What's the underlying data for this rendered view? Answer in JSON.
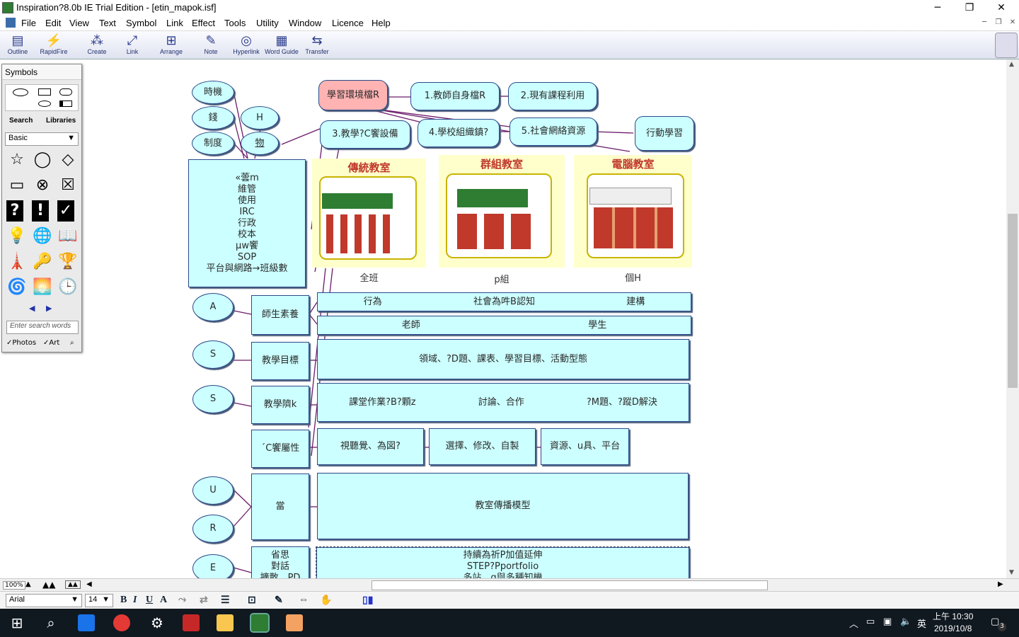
{
  "window": {
    "title": "Inspiration?8.0b IE Trial Edition - [etin_mapok.isf]",
    "min": "─",
    "max": "❐",
    "close": "✕"
  },
  "menu": [
    "File",
    "Edit",
    "View",
    "Text",
    "Symbol",
    "Link",
    "Effect",
    "Tools",
    "Utility",
    "Window",
    "Licence",
    "Help"
  ],
  "toolbar": [
    {
      "label": "Outline",
      "icon": "outline-icon"
    },
    {
      "label": "RapidFire",
      "icon": "rapidfire-icon"
    },
    {
      "label": "Create",
      "icon": "create-icon"
    },
    {
      "label": "Link",
      "icon": "link-icon"
    },
    {
      "label": "Arrange",
      "icon": "arrange-icon"
    },
    {
      "label": "Note",
      "icon": "note-icon"
    },
    {
      "label": "Hyperlink",
      "icon": "hyperlink-icon"
    },
    {
      "label": "Word Guide",
      "icon": "wordguide-icon"
    },
    {
      "label": "Transfer",
      "icon": "transfer-icon"
    }
  ],
  "palette": {
    "title": "Symbols",
    "tab_search": "Search",
    "tab_libraries": "Libraries",
    "library": "Basic",
    "search_placeholder": "Enter search words",
    "photos": "Photos",
    "art": "Art"
  },
  "diagram": {
    "left_small": [
      "時機",
      "錢",
      "H",
      "制度",
      "物"
    ],
    "left_box": [
      "«蕓m",
      "維管",
      "使用",
      "IRC",
      "行政",
      "校本",
      "µw饗",
      "SOP",
      "平台與網路→班級數"
    ],
    "top_row": [
      "學習環境檔R",
      "1.教師自身檔R",
      "2.現有課程利用"
    ],
    "second_row": [
      "3.教學?C饗設備",
      "4.學校組織鎮?",
      "5.社會網絡資源",
      "行動學習"
    ],
    "classrooms": [
      {
        "title": "傳統教室",
        "caption": "全班"
      },
      {
        "title": "群組教室",
        "caption": "p組"
      },
      {
        "title": "電腦教室",
        "caption": "個H"
      }
    ],
    "letters": [
      "A",
      "S",
      "S",
      "U",
      "R",
      "E"
    ],
    "mid": [
      "師生素養",
      "教學目標",
      "教學隮k",
      "´C饗屬性",
      "當",
      "省思\n對話\n擴散、PD"
    ],
    "row1": [
      "行為",
      "社會為吽B認知",
      "建構"
    ],
    "row2": [
      "老師",
      "學生"
    ],
    "row3": "領域、?D題、課表、學習目標、活動型態",
    "row4": [
      "課堂作業?B?顆z",
      "討論、合作",
      "?M題、?蹤D解決"
    ],
    "row5": [
      "視聽覺、為図?",
      "選擇、修改、自製",
      "資源、u具、平台"
    ],
    "row6": "教室傳播模型",
    "row7": [
      "持續為祈P加值延伸",
      "STEP?Pportfolio",
      "多站、g與多種知機"
    ]
  },
  "status": {
    "zoom": "100%"
  },
  "format": {
    "font": "Arial",
    "size": "14"
  },
  "clock": {
    "time": "上午 10:30",
    "date": "2019/10/8"
  },
  "tray": {
    "ime": "英",
    "notif": "3"
  }
}
